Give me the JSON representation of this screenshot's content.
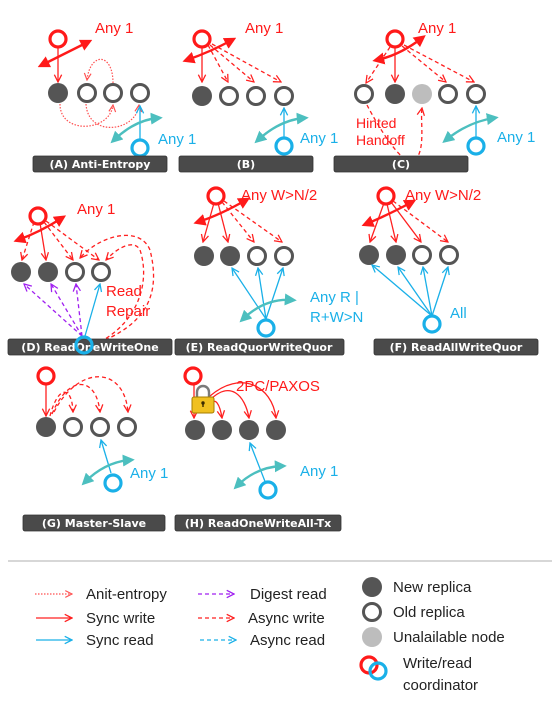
{
  "panels": {
    "a": {
      "label": "(A) Anti-Entropy",
      "write_quorum": "Any 1",
      "read_quorum": "Any 1"
    },
    "b": {
      "label": "(B)",
      "write_quorum": "Any 1",
      "read_quorum": "Any 1"
    },
    "c": {
      "label": "(C)",
      "write_quorum": "Any 1",
      "read_quorum": "Any 1",
      "note_line1": "Hinted",
      "note_line2": "Handoff"
    },
    "d": {
      "label": "(D) ReadOneWriteOne",
      "write_quorum": "Any 1",
      "note_line1": "Read",
      "note_line2": "Repair"
    },
    "e": {
      "label": "(E) ReadQuorWriteQuor",
      "write_quorum": "Any W>N/2",
      "read_quorum_line1": "Any R  |",
      "read_quorum_line2": "R+W>N"
    },
    "f": {
      "label": "(F) ReadAllWriteQuor",
      "write_quorum": "Any W>N/2",
      "read_quorum": "All"
    },
    "g": {
      "label": "(G) Master-Slave",
      "read_quorum": "Any 1"
    },
    "h": {
      "label": "(H) ReadOneWriteAll-Tx",
      "write_protocol": "2PC/PAXOS",
      "read_quorum": "Any 1"
    }
  },
  "legend": {
    "arrows": [
      {
        "label": "Anit-entropy",
        "style": "anti-entropy"
      },
      {
        "label": "Sync write",
        "style": "sync-write"
      },
      {
        "label": "Sync read",
        "style": "sync-read"
      },
      {
        "label": "Digest read",
        "style": "digest-read"
      },
      {
        "label": "Async write",
        "style": "async-write"
      },
      {
        "label": "Async read",
        "style": "async-read"
      }
    ],
    "nodes": [
      {
        "label": "New replica",
        "style": "new"
      },
      {
        "label": "Old replica",
        "style": "old"
      },
      {
        "label": "Unalailable node",
        "style": "unavailable"
      }
    ],
    "coordinator_line1": "Write/read",
    "coordinator_line2": "coordinator"
  },
  "colors": {
    "write": "#ff1a1a",
    "read": "#1ab0e8",
    "digest": "#a020f0",
    "any_read_arc": "#4cbfbf",
    "new_replica": "#555555",
    "unavailable": "#bdbdbd",
    "label_bar": "#4a4a4a"
  }
}
